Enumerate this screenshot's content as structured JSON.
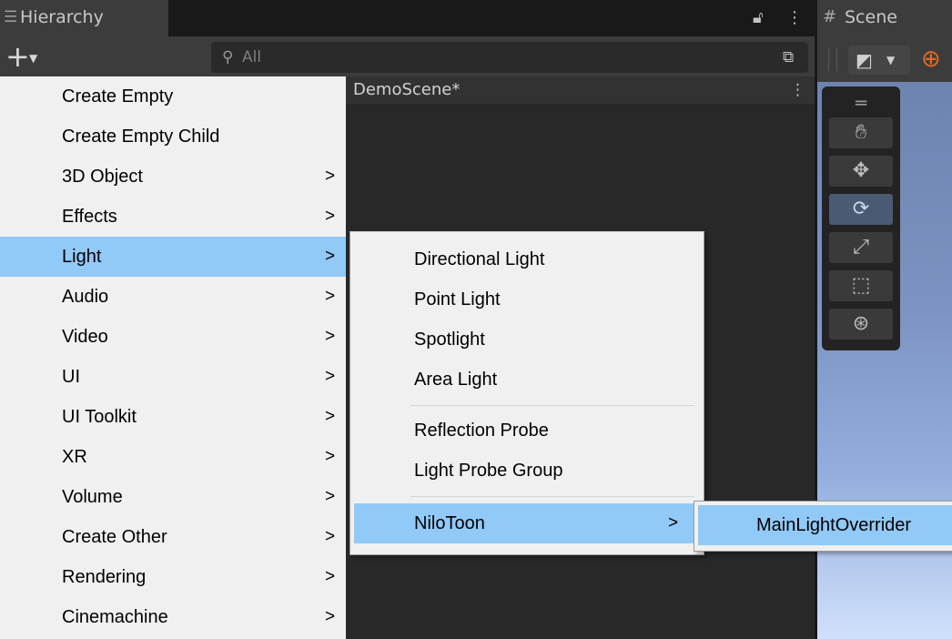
{
  "hierarchy": {
    "tab_title": "Hierarchy",
    "tab_icon": "list-icon",
    "search_placeholder": "All",
    "scene_name": "DemoScene*"
  },
  "scene_window": {
    "tab_title": "Scene",
    "tab_icon": "hash-icon",
    "globe_color": "#e26a20"
  },
  "tools": {
    "active": "rotate-tool",
    "items": [
      "hand-tool",
      "move-tool",
      "rotate-tool",
      "scale-tool",
      "rect-tool",
      "transform-tool"
    ]
  },
  "create_menu": {
    "highlight_color": "#91c9f7",
    "items": [
      {
        "label": "Create Empty",
        "arrow": ""
      },
      {
        "label": "Create Empty Child",
        "arrow": ""
      },
      {
        "label": "3D Object",
        "arrow": ">"
      },
      {
        "label": "Effects",
        "arrow": ">"
      },
      {
        "label": "Light",
        "arrow": ">"
      },
      {
        "label": "Audio",
        "arrow": ">"
      },
      {
        "label": "Video",
        "arrow": ">"
      },
      {
        "label": "UI",
        "arrow": ">"
      },
      {
        "label": "UI Toolkit",
        "arrow": ">"
      },
      {
        "label": "XR",
        "arrow": ">"
      },
      {
        "label": "Volume",
        "arrow": ">"
      },
      {
        "label": "Create Other",
        "arrow": ">"
      },
      {
        "label": "Rendering",
        "arrow": ">"
      },
      {
        "label": "Cinemachine",
        "arrow": ">"
      }
    ]
  },
  "light_menu": {
    "items": [
      {
        "label": "Directional Light",
        "arrow": ""
      },
      {
        "label": "Point Light",
        "arrow": ""
      },
      {
        "label": "Spotlight",
        "arrow": ""
      },
      {
        "label": "Area Light",
        "arrow": ""
      },
      {
        "label": "Reflection Probe",
        "arrow": ""
      },
      {
        "label": "Light Probe Group",
        "arrow": ""
      },
      {
        "label": "NiloToon",
        "arrow": ">"
      }
    ]
  },
  "nilotoon_menu": {
    "items": [
      {
        "label": "MainLightOverrider"
      }
    ]
  }
}
